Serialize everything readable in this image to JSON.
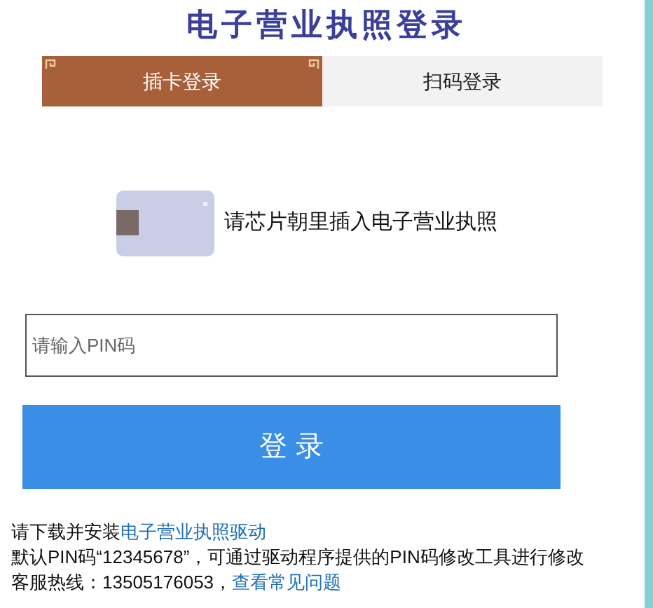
{
  "title": "电子营业执照登录",
  "tabs": [
    {
      "label": "插卡登录",
      "selected": true
    },
    {
      "label": "扫码登录",
      "selected": false
    }
  ],
  "instruction": "请芯片朝里插入电子营业执照",
  "pin_field": {
    "placeholder": "请输入PIN码"
  },
  "login_button": "登 录",
  "footer": [
    {
      "text": "请下载并安装",
      "link": "电子营业执照驱动"
    },
    {
      "text": "默认PIN码“12345678”，可通过驱动程序提供的PIN码修改工具进行修改"
    },
    {
      "text": "客服热线：13505176053，",
      "link": "查看常见问题"
    }
  ]
}
